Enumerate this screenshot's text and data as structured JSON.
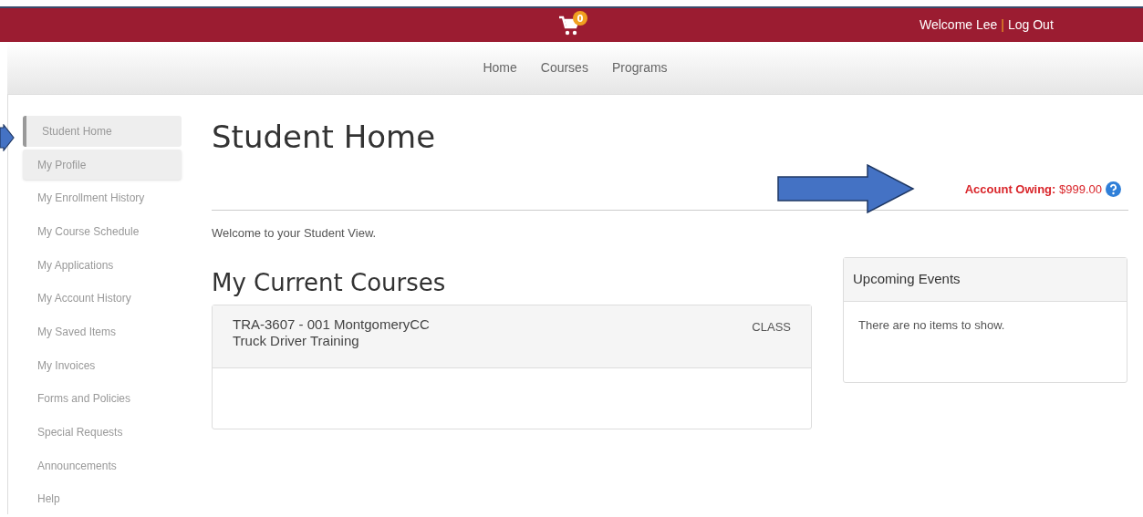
{
  "header": {
    "cart_count": "0",
    "welcome": "Welcome Lee",
    "separator": "|",
    "logout": "Log Out"
  },
  "nav": [
    "Home",
    "Courses",
    "Programs"
  ],
  "sidebar": {
    "items": [
      {
        "label": "Student Home",
        "selected": true,
        "hovered": false
      },
      {
        "label": "My Profile",
        "selected": false,
        "hovered": true
      },
      {
        "label": "My Enrollment History",
        "selected": false,
        "hovered": false
      },
      {
        "label": "My Course Schedule",
        "selected": false,
        "hovered": false
      },
      {
        "label": "My Applications",
        "selected": false,
        "hovered": false
      },
      {
        "label": "My Account History",
        "selected": false,
        "hovered": false
      },
      {
        "label": "My Saved Items",
        "selected": false,
        "hovered": false
      },
      {
        "label": "My Invoices",
        "selected": false,
        "hovered": false
      },
      {
        "label": "Forms and Policies",
        "selected": false,
        "hovered": false
      },
      {
        "label": "Special Requests",
        "selected": false,
        "hovered": false
      },
      {
        "label": "Announcements",
        "selected": false,
        "hovered": false
      },
      {
        "label": "Help",
        "selected": false,
        "hovered": false
      }
    ]
  },
  "page_title": "Student Home",
  "account": {
    "label": "Account Owing:",
    "amount": "$999.00"
  },
  "welcome_text": "Welcome to your Student View.",
  "courses": {
    "title": "My Current Courses",
    "items": [
      {
        "code": "TRA-3607 - 001 MontgomeryCC",
        "name": "Truck Driver Training",
        "type": "CLASS"
      }
    ]
  },
  "events": {
    "title": "Upcoming Events",
    "empty": "There are no items to show."
  }
}
